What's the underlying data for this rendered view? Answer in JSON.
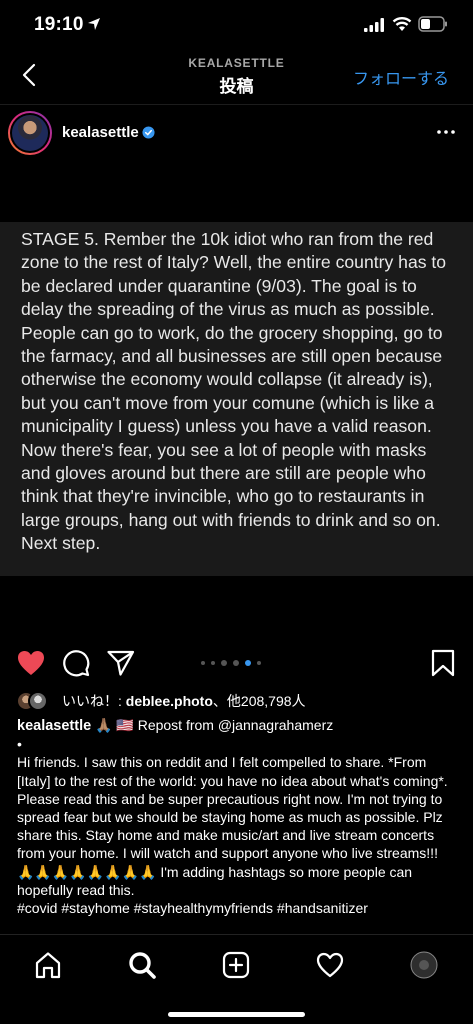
{
  "status_bar": {
    "time": "19:10"
  },
  "header": {
    "subtitle": "KEALASETTLE",
    "title": "投稿",
    "follow_label": "フォローする"
  },
  "post": {
    "username": "kealasettle",
    "media_text": "STAGE 5. Rember the 10k idiot who ran from the red zone to the rest of Italy? Well, the entire country has to be declared under quarantine (9/03). The goal is to delay the spreading of the virus as much as possible. People can go to work, do the grocery shopping, go to the farmacy, and all businesses are still open because otherwise the economy would collapse (it already is), but you can't move from your comune (which is like a municipality I guess) unless you have a valid reason. Now there's fear, you see a lot of people with masks and gloves around but there are still are people who think that they're invincible, who go to restaurants in large groups, hang out with friends to drink and so on. Next step.",
    "carousel": {
      "count": 6,
      "active_index": 4
    },
    "likes": {
      "prefix": "いいね！: ",
      "user": "deblee.photo",
      "suffix": "、他208,798人"
    },
    "caption": {
      "username": "kealasettle",
      "head_rest": " 🙏🏽 🇺🇸  Repost from @jannagrahamerz",
      "body": "•\nHi friends. I saw this on reddit and I felt compelled to share. *From [Italy] to the rest of the world: you have no idea about what's coming*. Please read this and be super precautious right now. I'm not trying to spread fear but we should be staying home as much as possible. Plz share this. Stay home and make music/art and live stream concerts from your home. I will watch and support anyone who live streams!!! 🙏🙏🙏🙏🙏🙏🙏🙏 I'm adding hashtags so more people can hopefully read this.\n#covid #stayhome #stayhealthymyfriends #handsanitizer"
    }
  },
  "colors": {
    "accent": "#3897f0",
    "like_red": "#ed4956",
    "background": "#000000",
    "media_box": "#1a1a1a"
  },
  "icons": {
    "status": [
      "location-arrow-icon",
      "signal-icon",
      "wifi-icon",
      "battery-icon"
    ],
    "actions": [
      "heart-icon",
      "comment-icon",
      "share-icon",
      "bookmark-icon"
    ],
    "nav": [
      "home-icon",
      "search-icon",
      "add-icon",
      "activity-heart-icon",
      "profile-avatar"
    ]
  }
}
